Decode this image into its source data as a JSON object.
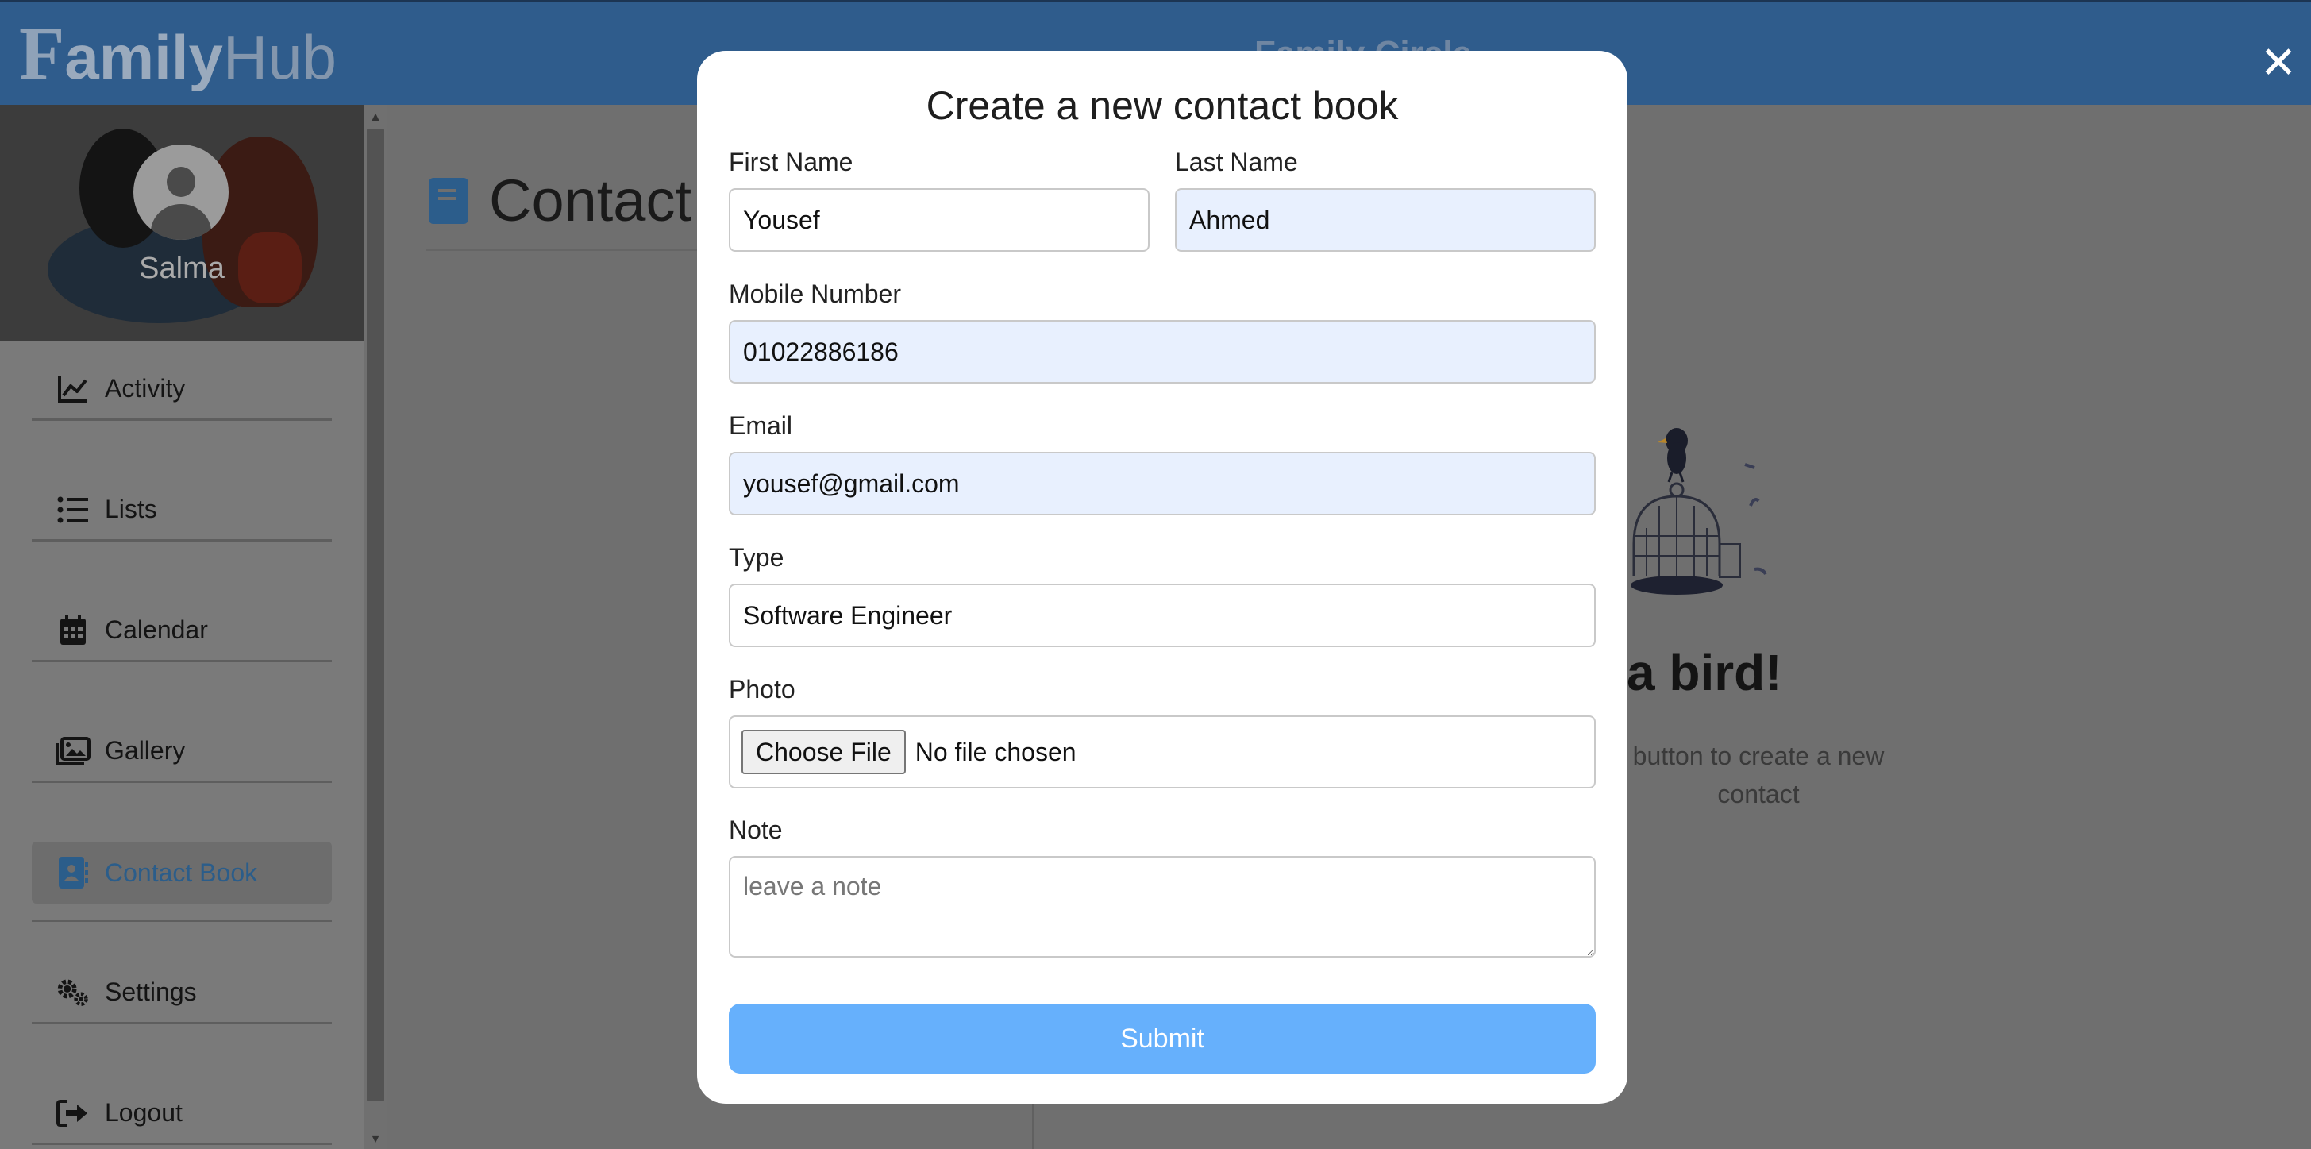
{
  "app": {
    "logo_initial": "F",
    "logo_family": "amily",
    "logo_hub": "Hub",
    "top_title": "Family Circle",
    "close_symbol": "✕"
  },
  "sidebar": {
    "user_name": "Salma",
    "items": [
      {
        "label": "Activity",
        "icon": "chart-line-icon"
      },
      {
        "label": "Lists",
        "icon": "list-icon"
      },
      {
        "label": "Calendar",
        "icon": "calendar-icon"
      },
      {
        "label": "Gallery",
        "icon": "images-icon"
      },
      {
        "label": "Contact Book",
        "icon": "address-book-icon",
        "active": true
      },
      {
        "label": "Settings",
        "icon": "gears-icon"
      },
      {
        "label": "Logout",
        "icon": "logout-icon"
      }
    ]
  },
  "content": {
    "title": "Contact",
    "empty_title": "as a bird!",
    "empty_text_line1": "button to create a new",
    "empty_text_line2": "contact"
  },
  "modal": {
    "title": "Create a new contact book",
    "first_name_label": "First Name",
    "first_name_value": "Yousef",
    "last_name_label": "Last Name",
    "last_name_value": "Ahmed",
    "mobile_label": "Mobile Number",
    "mobile_value": "01022886186",
    "email_label": "Email",
    "email_value": "yousef@gmail.com",
    "type_label": "Type",
    "type_value": "Software Engineer",
    "photo_label": "Photo",
    "choose_file_label": "Choose File",
    "file_status": "No file chosen",
    "note_label": "Note",
    "note_placeholder": "leave a note",
    "submit_label": "Submit"
  },
  "colors": {
    "header_bg": "#2f5c8c",
    "submit_bg": "#66b0fc",
    "autofill_bg": "#e8f0fe",
    "active_nav_text": "#2b5d8a"
  }
}
